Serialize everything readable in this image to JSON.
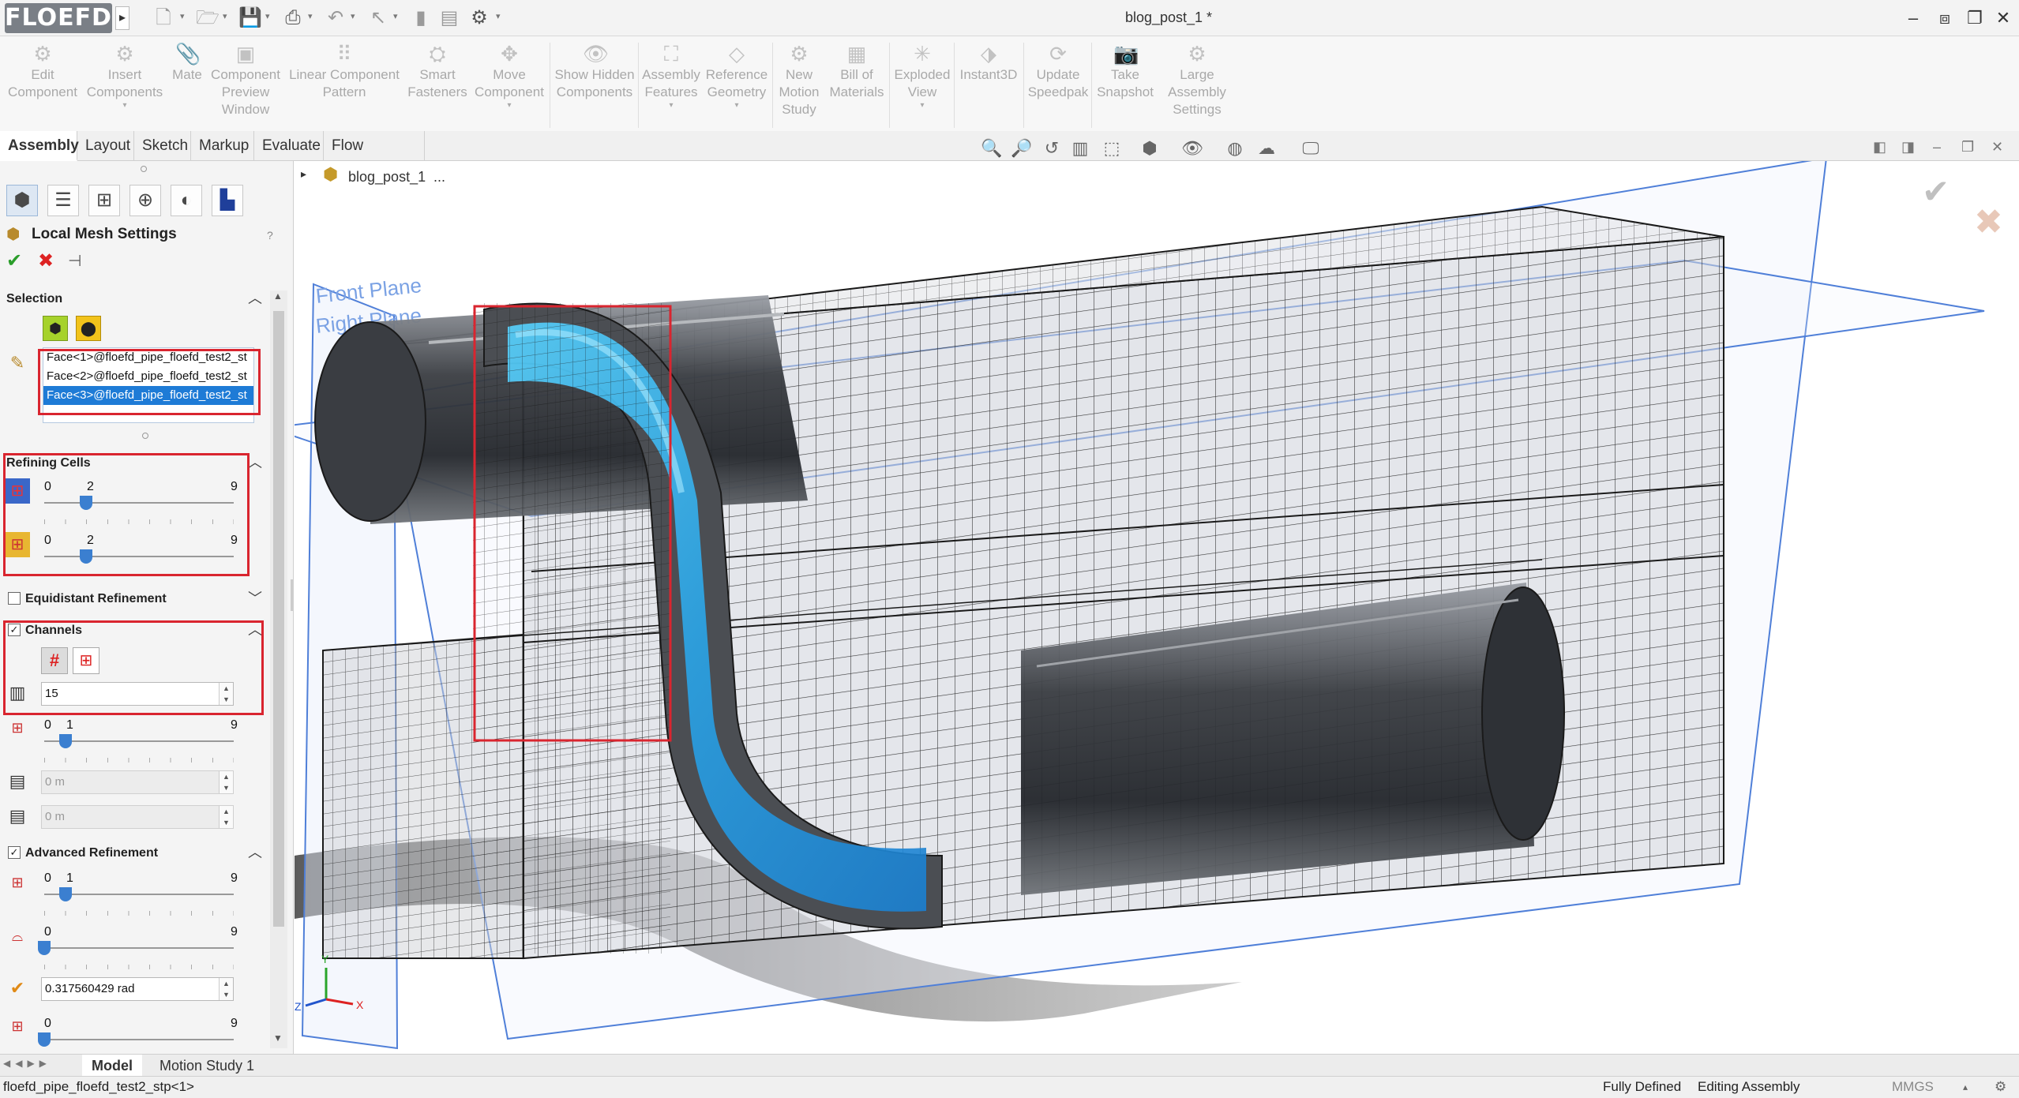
{
  "app": {
    "logo_text": "FLOEFD",
    "document_title": "blog_post_1 *"
  },
  "ribbon": {
    "buttons": [
      {
        "label": "Edit Component",
        "icon": "edit-component-icon"
      },
      {
        "label": "Insert Components",
        "icon": "insert-components-icon"
      },
      {
        "label": "Mate",
        "icon": "mate-icon"
      },
      {
        "label": "Component Preview Window",
        "icon": "preview-window-icon"
      },
      {
        "label": "Linear Component Pattern",
        "icon": "pattern-icon"
      },
      {
        "label": "Smart Fasteners",
        "icon": "fastener-icon"
      },
      {
        "label": "Move Component",
        "icon": "move-component-icon"
      },
      {
        "label": "Show Hidden Components",
        "icon": "show-hidden-icon"
      },
      {
        "label": "Assembly Features",
        "icon": "assembly-features-icon"
      },
      {
        "label": "Reference Geometry",
        "icon": "reference-geometry-icon"
      },
      {
        "label": "New Motion Study",
        "icon": "motion-study-icon"
      },
      {
        "label": "Bill of Materials",
        "icon": "bom-icon"
      },
      {
        "label": "Exploded View",
        "icon": "exploded-view-icon"
      },
      {
        "label": "Instant3D",
        "icon": "instant3d-icon"
      },
      {
        "label": "Update Speedpak",
        "icon": "speedpak-icon"
      },
      {
        "label": "Take Snapshot",
        "icon": "snapshot-icon"
      },
      {
        "label": "Large Assembly Settings",
        "icon": "large-assembly-icon"
      }
    ]
  },
  "tabs": [
    "Assembly",
    "Layout",
    "Sketch",
    "Markup",
    "Evaluate",
    "Flow Analysis"
  ],
  "breadcrumb": "blog_post_1",
  "breadcrumb_more": "...",
  "panel": {
    "title": "Local Mesh Settings",
    "help": "?",
    "selection": {
      "title": "Selection",
      "faces": [
        "Face<1>@floefd_pipe_floefd_test2_st",
        "Face<2>@floefd_pipe_floefd_test2_st",
        "Face<3>@floefd_pipe_floefd_test2_st"
      ]
    },
    "refining_cells": {
      "title": "Refining Cells",
      "slider1": {
        "min": "0",
        "value": "2",
        "max": "9",
        "value_num": 2
      },
      "slider2": {
        "min": "0",
        "value": "2",
        "max": "9",
        "value_num": 2
      }
    },
    "equidistant": {
      "title": "Equidistant Refinement",
      "checked": false
    },
    "channels": {
      "title": "Channels",
      "checked": true,
      "count_value": "15",
      "slider": {
        "min": "0",
        "value": "1",
        "max": "9",
        "value_num": 1
      },
      "min_width": "0 m",
      "max_width": "0 m"
    },
    "advanced": {
      "title": "Advanced Refinement",
      "checked": true,
      "slider1": {
        "min": "0",
        "value": "1",
        "max": "9",
        "value_num": 1
      },
      "slider2": {
        "min": "0",
        "max": "9",
        "value_num": 0
      },
      "angle_value": "0.317560429 rad",
      "slider3": {
        "min": "0",
        "max": "9",
        "value_num": 0
      }
    }
  },
  "viewport": {
    "plane_front": "Front Plane",
    "plane_right": "Right Plane",
    "colors": {
      "fluid": "#3ab8ee",
      "pipe": "#3f4247",
      "mesh": "#1a1a1a",
      "plane": "#4f7fd8",
      "highlight": "#d9252f"
    }
  },
  "bottom_tabs": [
    "Model",
    "Motion Study 1"
  ],
  "status": {
    "left": "floefd_pipe_floefd_test2_stp<1>",
    "fully_defined": "Fully Defined",
    "editing": "Editing Assembly",
    "units": "MMGS"
  }
}
